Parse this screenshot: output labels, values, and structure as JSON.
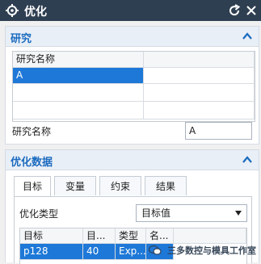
{
  "window": {
    "title": "优化"
  },
  "study_section": {
    "header": "研究",
    "table": {
      "column_header": "研究名称",
      "rows": [
        "A"
      ]
    },
    "name_label": "研究名称",
    "name_value": "A"
  },
  "optimization_section": {
    "header": "优化数据",
    "tabs": [
      "目标",
      "变量",
      "约束",
      "结果"
    ],
    "type_label": "优化类型",
    "type_value": "目标值",
    "grid": {
      "headers": [
        "目标",
        "目...",
        "类型",
        "名..."
      ],
      "row": [
        "p128",
        "40",
        "Exp...",
        ""
      ]
    }
  },
  "watermark": "三多数控与模具工作室",
  "icons": [
    "gear-icon",
    "refresh-icon",
    "close-icon",
    "chevron-up-icon",
    "chevron-down-icon",
    "wechat-icon"
  ],
  "colors": {
    "titlebar": "#2f3f52",
    "section_header": "#1b6bbf",
    "selection": "#1e78d7"
  }
}
